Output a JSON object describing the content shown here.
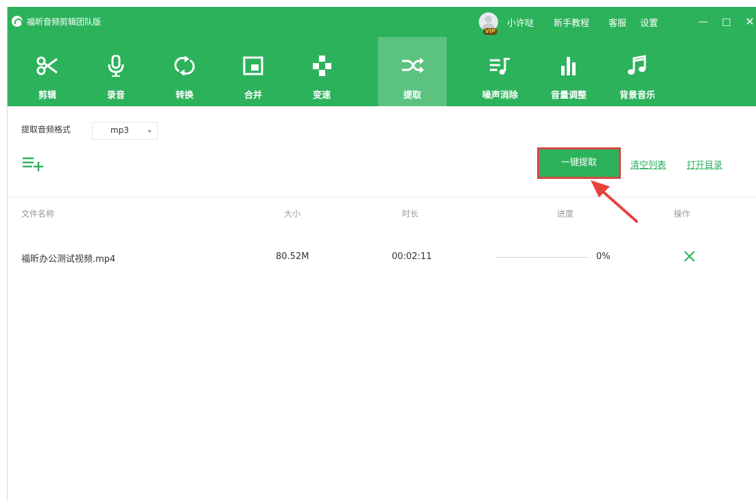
{
  "app": {
    "title": "福昕音频剪辑团队版",
    "user_name": "小许哒",
    "vip_label": "VIP",
    "links": {
      "tutorial": "新手教程",
      "service": "客服",
      "settings": "设置"
    },
    "window_controls": {
      "minimize": "—",
      "maximize": "□",
      "close": "✕"
    }
  },
  "toolbar": {
    "active": "extract",
    "items": [
      {
        "id": "edit",
        "label": "剪辑",
        "icon": "scissors-icon"
      },
      {
        "id": "record",
        "label": "录音",
        "icon": "microphone-icon"
      },
      {
        "id": "convert",
        "label": "转换",
        "icon": "convert-arrows-icon"
      },
      {
        "id": "merge",
        "label": "合并",
        "icon": "merge-icon"
      },
      {
        "id": "speed",
        "label": "变速",
        "icon": "speed-icon"
      },
      {
        "id": "extract",
        "label": "提取",
        "icon": "shuffle-icon"
      },
      {
        "id": "denoise",
        "label": "噪声消除",
        "icon": "denoise-icon"
      },
      {
        "id": "volume",
        "label": "音量调整",
        "icon": "volume-bars-icon"
      },
      {
        "id": "bgm",
        "label": "背景音乐",
        "icon": "music-note-icon"
      }
    ]
  },
  "format": {
    "label": "提取音频格式",
    "selected": "mp3"
  },
  "actions": {
    "extract_all": "一键提取",
    "clear_list": "清空列表",
    "open_folder": "打开目录"
  },
  "table": {
    "headers": {
      "name": "文件名称",
      "size": "大小",
      "duration": "时长",
      "progress": "进度",
      "operation": "操作"
    },
    "rows": [
      {
        "name": "福昕办公测试视频.mp4",
        "size": "80.52M",
        "duration": "00:02:11",
        "progress_text": "0%",
        "progress": 0
      }
    ]
  },
  "colors": {
    "brand": "#2db25c",
    "highlight_border": "#d6483f",
    "annotation_arrow": "#e8403a"
  }
}
